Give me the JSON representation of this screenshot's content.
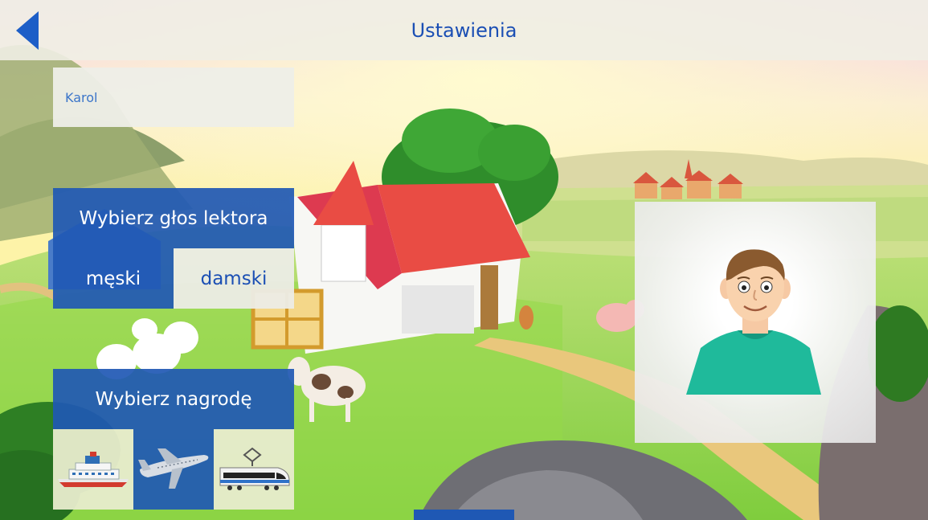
{
  "header": {
    "title": "Ustawienia",
    "back_icon": "back-arrow-icon"
  },
  "profile": {
    "name_value": "Karol"
  },
  "voice_panel": {
    "title": "Wybierz głos lektora",
    "options": [
      {
        "label": "męski",
        "selected": true
      },
      {
        "label": "damski",
        "selected": false
      }
    ]
  },
  "reward_panel": {
    "title": "Wybierz nagrodę",
    "options": [
      {
        "icon": "ship-icon",
        "selected": false
      },
      {
        "icon": "airplane-icon",
        "selected": true
      },
      {
        "icon": "train-icon",
        "selected": false
      }
    ]
  },
  "colors": {
    "accent_blue": "#1f58b4",
    "title_blue": "#1b4fb4",
    "light_panel": "#ecece6",
    "shirt_teal": "#1fba9b"
  }
}
